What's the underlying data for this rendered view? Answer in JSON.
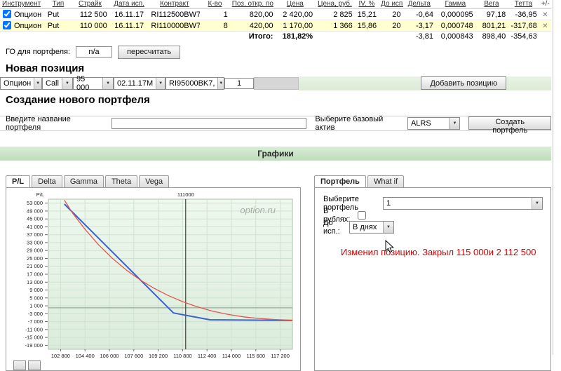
{
  "table": {
    "headers": [
      "Инструмент",
      "Тип",
      "Страйк",
      "Дата исп.",
      "Контракт",
      "К-во",
      "Поз. откр. по",
      "Цена",
      "Цена, руб.",
      "IV. %",
      "До исп.",
      "Дельта",
      "Гамма",
      "Вега",
      "Тетта",
      "+/-"
    ],
    "rows": [
      {
        "instrument": "Опцион",
        "type": "Put",
        "strike": "112 500",
        "date": "16.11.17",
        "contract": "RI112500BW7",
        "qty": "1",
        "open": "820,00",
        "price": "2 420,00",
        "price_rub": "2 825",
        "iv": "15,21",
        "days": "20",
        "delta": "-0,64",
        "gamma": "0,000095",
        "vega": "97,18",
        "theta": "-36,95",
        "delete_icon": "✕"
      },
      {
        "instrument": "Опцион",
        "type": "Put",
        "strike": "110 000",
        "date": "16.11.17",
        "contract": "RI110000BW7",
        "qty": "8",
        "open": "420,00",
        "price": "1 170,00",
        "price_rub": "1 366",
        "iv": "15,86",
        "days": "20",
        "delta": "-3,17",
        "gamma": "0,000748",
        "vega": "801,21",
        "theta": "-317,68",
        "delete_icon": "✕"
      }
    ],
    "totals": {
      "label": "Итого:",
      "percent": "181,82%",
      "delta": "-3,81",
      "gamma": "0,000843",
      "vega": "898,40",
      "theta": "-354,63"
    }
  },
  "margin_row": {
    "label": "ГО для портфеля:",
    "value": "n/a",
    "recalc_button": "пересчитать"
  },
  "new_position": {
    "title": "Новая позиция",
    "type": "Опцион",
    "side": "Call",
    "strike": "95 000",
    "date": "02.11.17М",
    "contract": "RI95000BK7,",
    "qty": "1",
    "add_button": "Добавить позицию"
  },
  "new_portfolio": {
    "title": "Создание нового портфеля",
    "name_label": "Введите название портфеля",
    "asset_label": "Выберите базовый актив",
    "asset": "ALRS",
    "create_button": "Создать портфель"
  },
  "charts_header": "Графики",
  "left_tabs": [
    "P/L",
    "Delta",
    "Gamma",
    "Theta",
    "Vega"
  ],
  "right_tabs": [
    "Портфель",
    "What if"
  ],
  "right_panel": {
    "portfolio_label": "Выберите портфель",
    "portfolio": "1",
    "rub_label": "В рублях:",
    "exp_label": "До исп.:",
    "exp_value": "В днях",
    "note": "Изменил позицию. Закрыл 115 000и 2 112 500"
  },
  "chart_data": {
    "type": "line",
    "ylabel": "P/L",
    "watermark": "option.ru",
    "marker": {
      "x": 111000,
      "label": "111000"
    },
    "xlim": [
      102000,
      118000
    ],
    "ylim": [
      -21000,
      55000
    ],
    "grid": true,
    "x_ticks": [
      102800,
      104400,
      106000,
      107600,
      109200,
      110800,
      112400,
      114000,
      115600,
      117200
    ],
    "y_ticks": [
      53000,
      49000,
      45000,
      41000,
      37000,
      33000,
      29000,
      25000,
      21000,
      17000,
      13000,
      9000,
      5000,
      1000,
      -3000,
      -7000,
      -11000,
      -15000,
      -19000
    ],
    "series": [
      {
        "name": "expiration-pl",
        "color": "#3b62c9",
        "width": 2,
        "points": [
          [
            103050,
            52500
          ],
          [
            110200,
            -2600
          ],
          [
            112600,
            -6100
          ],
          [
            118000,
            -6400
          ]
        ]
      },
      {
        "name": "current-pl",
        "color": "#e2574f",
        "width": 1.3,
        "points": [
          [
            103050,
            54500
          ],
          [
            103600,
            47800
          ],
          [
            104400,
            39800
          ],
          [
            105300,
            31800
          ],
          [
            106200,
            25000
          ],
          [
            107100,
            19200
          ],
          [
            108000,
            14200
          ],
          [
            108900,
            10000
          ],
          [
            109800,
            6400
          ],
          [
            110800,
            3100
          ],
          [
            111800,
            400
          ],
          [
            112800,
            -1800
          ],
          [
            113800,
            -3400
          ],
          [
            114800,
            -4600
          ],
          [
            115800,
            -5400
          ],
          [
            116800,
            -5900
          ],
          [
            118000,
            -6300
          ]
        ]
      }
    ]
  }
}
